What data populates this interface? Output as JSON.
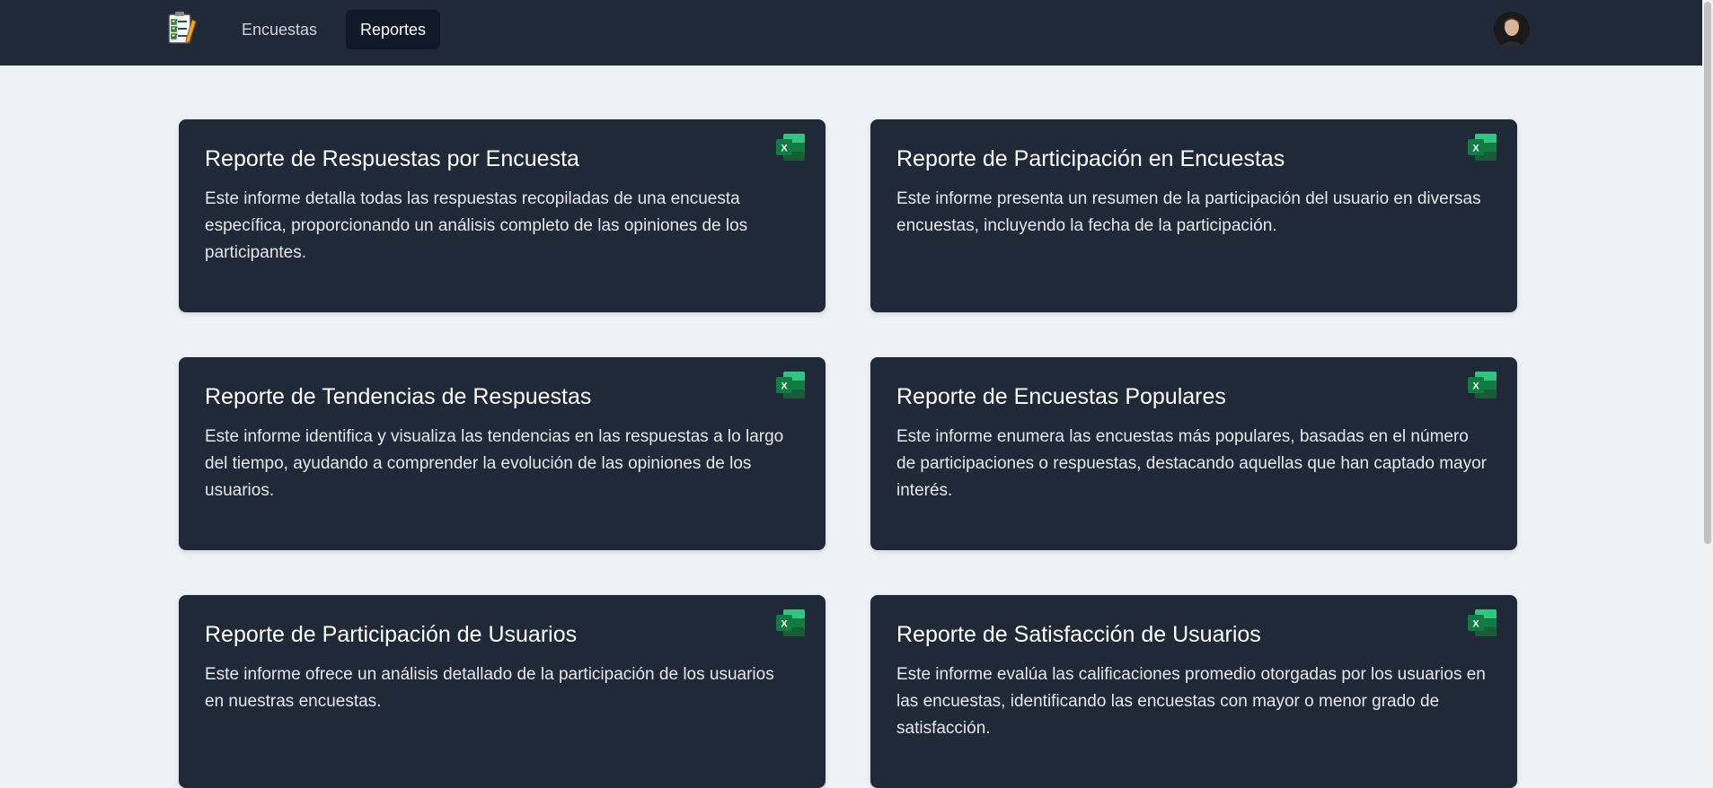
{
  "nav": {
    "logo_icon": "survey-clipboard-icon",
    "links": [
      {
        "label": "Encuestas",
        "active": false
      },
      {
        "label": "Reportes",
        "active": true
      }
    ],
    "avatar_icon": "user-avatar"
  },
  "colors": {
    "navbar_bg": "#1f2937",
    "page_bg": "#eef1f6",
    "card_bg": "#1f2937",
    "active_tab_bg": "#111827",
    "excel_green": "#1d7044"
  },
  "reports": [
    {
      "title": "Reporte de Respuestas por Encuesta",
      "description": "Este informe detalla todas las respuestas recopiladas de una encuesta específica, proporcionando un análisis completo de las opiniones de los participantes.",
      "icon": "excel-icon"
    },
    {
      "title": "Reporte de Participación en Encuestas",
      "description": "Este informe presenta un resumen de la participación del usuario en diversas encuestas, incluyendo la fecha de la participación.",
      "icon": "excel-icon"
    },
    {
      "title": "Reporte de Tendencias de Respuestas",
      "description": "Este informe identifica y visualiza las tendencias en las respuestas a lo largo del tiempo, ayudando a comprender la evolución de las opiniones de los usuarios.",
      "icon": "excel-icon"
    },
    {
      "title": "Reporte de Encuestas Populares",
      "description": "Este informe enumera las encuestas más populares, basadas en el número de participaciones o respuestas, destacando aquellas que han captado mayor interés.",
      "icon": "excel-icon"
    },
    {
      "title": "Reporte de Participación de Usuarios",
      "description": "Este informe ofrece un análisis detallado de la participación de los usuarios en nuestras encuestas.",
      "icon": "excel-icon"
    },
    {
      "title": "Reporte de Satisfacción de Usuarios",
      "description": "Este informe evalúa las calificaciones promedio otorgadas por los usuarios en las encuestas, identificando las encuestas con mayor o menor grado de satisfacción.",
      "icon": "excel-icon"
    }
  ]
}
